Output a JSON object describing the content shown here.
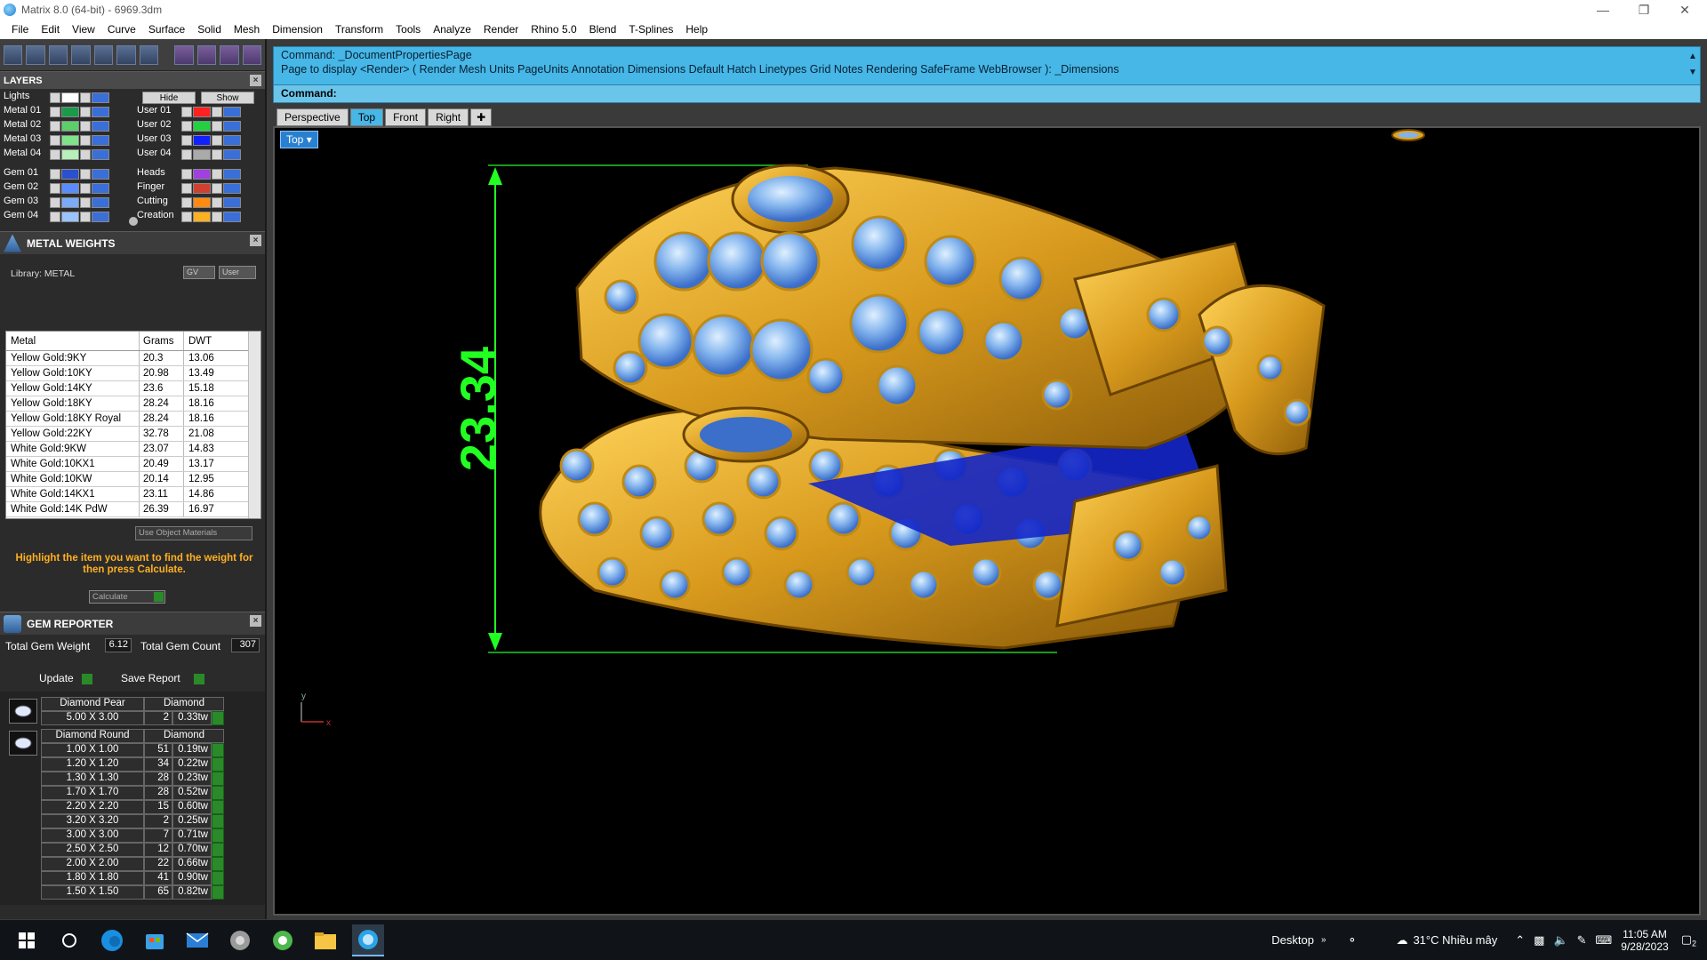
{
  "window": {
    "title": "Matrix 8.0 (64-bit) - 6969.3dm"
  },
  "menu": [
    "File",
    "Edit",
    "View",
    "Curve",
    "Surface",
    "Solid",
    "Mesh",
    "Dimension",
    "Transform",
    "Tools",
    "Analyze",
    "Render",
    "Rhino 5.0",
    "Blend",
    "T-Splines",
    "Help"
  ],
  "layers": {
    "title": "LAYERS",
    "lights_label": "Lights",
    "hide_label": "Hide",
    "show_label": "Show",
    "left": [
      "Metal 01",
      "Metal 02",
      "Metal 03",
      "Metal 04",
      "Gem 01",
      "Gem 02",
      "Gem 03",
      "Gem 04"
    ],
    "right": [
      "User 01",
      "User 02",
      "User 03",
      "User 04",
      "Heads",
      "Finger",
      "Cutting",
      "Creation"
    ],
    "left_colors": [
      "#1a9a4a",
      "#5ccf6a",
      "#7fe38a",
      "#b4f0b8",
      "#2a4fcf",
      "#5a8cff",
      "#7aaaf8",
      "#9bc3ff"
    ],
    "right_colors": [
      "#ff2020",
      "#22d040",
      "#1020ff",
      "#aaaaaa",
      "#a040e0",
      "#d04030",
      "#ff8a10",
      "#ffb020"
    ]
  },
  "metal_weights": {
    "title": "METAL WEIGHTS",
    "library": "Library: METAL",
    "btn_gv": "GV",
    "btn_user": "User",
    "columns": [
      "Metal",
      "Grams",
      "DWT"
    ],
    "rows": [
      [
        "Yellow Gold:9KY",
        "20.3",
        "13.06"
      ],
      [
        "Yellow Gold:10KY",
        "20.98",
        "13.49"
      ],
      [
        "Yellow Gold:14KY",
        "23.6",
        "15.18"
      ],
      [
        "Yellow Gold:18KY",
        "28.24",
        "18.16"
      ],
      [
        "Yellow Gold:18KY Royal",
        "28.24",
        "18.16"
      ],
      [
        "Yellow Gold:22KY",
        "32.78",
        "21.08"
      ],
      [
        "White Gold:9KW",
        "23.07",
        "14.83"
      ],
      [
        "White Gold:10KX1",
        "20.49",
        "13.17"
      ],
      [
        "White Gold:10KW",
        "20.14",
        "12.95"
      ],
      [
        "White Gold:14KX1",
        "23.11",
        "14.86"
      ],
      [
        "White Gold:14K PdW",
        "26.39",
        "16.97"
      ]
    ],
    "use_object_materials": "Use Object Materials",
    "hint": "Highlight the item you want to find the weight for then press Calculate.",
    "calculate": "Calculate"
  },
  "gem_reporter": {
    "title": "GEM REPORTER",
    "total_weight_label": "Total Gem Weight",
    "total_weight": "6.12",
    "total_count_label": "Total Gem Count",
    "total_count": "307",
    "update": "Update",
    "save_report": "Save Report",
    "groups": [
      {
        "shape": "Diamond Pear",
        "material": "Diamond",
        "rows": [
          [
            "5.00 X 3.00",
            "2",
            "0.33tw"
          ]
        ]
      },
      {
        "shape": "Diamond Round",
        "material": "Diamond",
        "rows": [
          [
            "1.00 X 1.00",
            "51",
            "0.19tw"
          ],
          [
            "1.20 X 1.20",
            "34",
            "0.22tw"
          ],
          [
            "1.30 X 1.30",
            "28",
            "0.23tw"
          ],
          [
            "1.70 X 1.70",
            "28",
            "0.52tw"
          ],
          [
            "2.20 X 2.20",
            "15",
            "0.60tw"
          ],
          [
            "3.20 X 3.20",
            "2",
            "0.25tw"
          ],
          [
            "3.00 X 3.00",
            "7",
            "0.71tw"
          ],
          [
            "2.50 X 2.50",
            "12",
            "0.70tw"
          ],
          [
            "2.00 X 2.00",
            "22",
            "0.66tw"
          ],
          [
            "1.80 X 1.80",
            "41",
            "0.90tw"
          ],
          [
            "1.50 X 1.50",
            "65",
            "0.82tw"
          ]
        ]
      }
    ]
  },
  "command": {
    "line1": "Command: _DocumentPropertiesPage",
    "line2": "Page to display <Render> ( Render  Mesh  Units  PageUnits  Annotation  Dimensions  Default  Hatch  Linetypes  Grid  Notes  Rendering  SafeFrame  WebBrowser ): _Dimensions",
    "prompt": "Command:"
  },
  "viewtabs": [
    "Perspective",
    "Top",
    "Front",
    "Right"
  ],
  "active_view": "Top",
  "viewport": {
    "label": "Top",
    "dimension": "23.34",
    "axis_y": "y",
    "axis_x": "x"
  },
  "taskbar": {
    "desktop": "Desktop",
    "weather": "31°C  Nhiều mây",
    "time": "11:05 AM",
    "date": "9/28/2023",
    "notification_count": "2"
  },
  "colors": {
    "accent": "#46b7e6",
    "dimension": "#22ff22",
    "gold": "#e0a623",
    "gem": "#7fb3f0"
  }
}
